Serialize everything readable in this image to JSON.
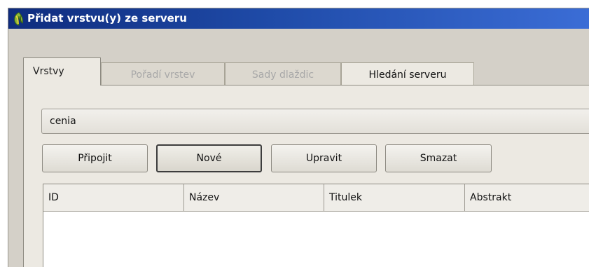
{
  "window": {
    "title": "Přidat vrstvu(y) ze serveru"
  },
  "tabs": [
    {
      "label": "Vrstvy",
      "state": "active"
    },
    {
      "label": "Pořadí vrstev",
      "state": "disabled"
    },
    {
      "label": "Sady dlaždic",
      "state": "disabled"
    },
    {
      "label": "Hledání serveru",
      "state": "enabled"
    }
  ],
  "connection": {
    "selected": "cenia"
  },
  "buttons": {
    "connect": "Připojit",
    "new": "Nové",
    "edit": "Upravit",
    "delete": "Smazat"
  },
  "table": {
    "columns": [
      "ID",
      "Název",
      "Titulek",
      "Abstrakt"
    ],
    "rows": []
  },
  "colors": {
    "titlebar_start": "#0f2c7e",
    "titlebar_end": "#3b6dd6",
    "dialog_bg": "#ece9e2",
    "disabled_text": "#a8a8a8"
  },
  "icons": {
    "app": "qgis-icon"
  }
}
